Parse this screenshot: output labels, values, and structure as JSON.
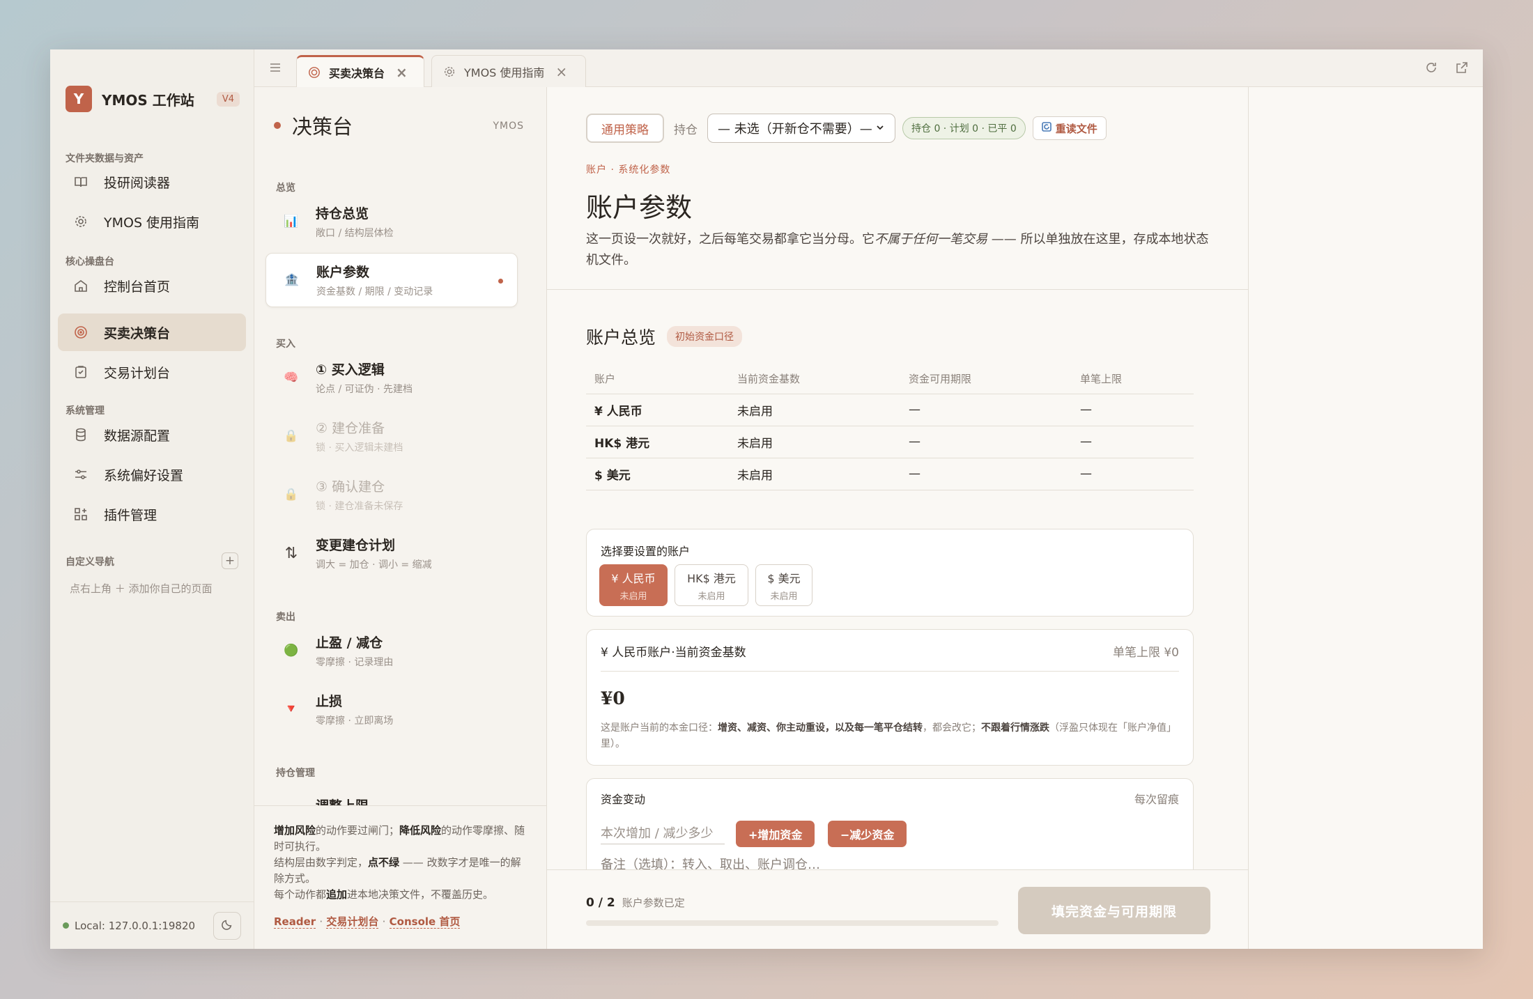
{
  "brand": {
    "logo": "Y",
    "name": "YMOS 工作站",
    "version": "V4"
  },
  "sidebar": {
    "sections": [
      "文件夹数据与资产",
      "核心操盘台",
      "系统管理",
      "自定义导航"
    ],
    "items": [
      {
        "label": "投研阅读器",
        "icon": "book-icon"
      },
      {
        "label": "YMOS 使用指南",
        "icon": "gear-icon"
      },
      {
        "label": "控制台首页",
        "icon": "home-icon"
      },
      {
        "label": "买卖决策台",
        "icon": "target-icon",
        "active": true
      },
      {
        "label": "交易计划台",
        "icon": "clipboard-icon"
      },
      {
        "label": "数据源配置",
        "icon": "database-icon"
      },
      {
        "label": "系统偏好设置",
        "icon": "sliders-icon"
      },
      {
        "label": "插件管理",
        "icon": "plugin-icon"
      }
    ],
    "custom_hint": "点右上角 ＋ 添加你自己的页面",
    "footer": "Local: 127.0.0.1:19820"
  },
  "tabs": [
    {
      "label": "买卖决策台",
      "active": true
    },
    {
      "label": "YMOS 使用指南",
      "active": false
    }
  ],
  "panel": {
    "title": "决策台",
    "tag": "YMOS",
    "sections": [
      "总览",
      "买入",
      "卖出",
      "持仓管理"
    ],
    "items": [
      {
        "title": "持仓总览",
        "sub": "敞口 / 结构层体检",
        "icon": "📊"
      },
      {
        "title": "账户参数",
        "sub": "资金基数 / 期限 / 变动记录",
        "icon": "🏦"
      },
      {
        "title": "① 买入逻辑",
        "sub": "论点 / 可证伪 · 先建档",
        "icon": "🧠"
      },
      {
        "title": "② 建仓准备",
        "sub": "锁 · 买入逻辑未建档",
        "icon": "🔒"
      },
      {
        "title": "③ 确认建仓",
        "sub": "锁 · 建仓准备未保存",
        "icon": "🔒"
      },
      {
        "title": "变更建仓计划",
        "sub": "调大 = 加仓 · 调小 = 缩减",
        "icon": "⇅"
      },
      {
        "title": "止盈 / 减仓",
        "sub": "零摩擦 · 记录理由",
        "icon": "🟢"
      },
      {
        "title": "止损",
        "sub": "零摩擦 · 立即离场",
        "icon": "🔻"
      }
    ],
    "peek": "调整上限",
    "foot": {
      "l1a": "增加风险",
      "l1b": "的动作要过闸门；",
      "l1c": "降低风险",
      "l1d": "的动作零摩擦、随时可执行。",
      "l2a": "结构层由数字判定，",
      "l2b": "点不绿",
      "l2c": " —— 改数字才是唯一的解除方式。",
      "l3a": "每个动作都",
      "l3b": "追加",
      "l3c": "进本地决策文件，不覆盖历史。",
      "links": [
        "Reader",
        "交易计划台",
        "Console 首页"
      ],
      "link_sep": "·"
    }
  },
  "main": {
    "strategy": "通用策略",
    "hold_label": "持仓",
    "hold_select": "— 未选（开新仓不需要）—",
    "status_badge": "持仓 0 · 计划 0 · 已平 0",
    "reread": "重读文件",
    "crumb": "账户 · 系统化参数",
    "title": "账户参数",
    "desc_a": "这一页设一次就好，之后每笔交易都拿它当分母。它",
    "desc_b": "不属于任何一笔交易",
    "desc_c": " —— 所以单独放在这里，存成本地状态机文件。",
    "overview_title": "账户总览",
    "overview_badge": "初始资金口径",
    "table": {
      "headers": [
        "账户",
        "当前资金基数",
        "资金可用期限",
        "单笔上限"
      ],
      "rows": [
        [
          "¥ 人民币",
          "未启用",
          "—",
          "—"
        ],
        [
          "HK$ 港元",
          "未启用",
          "—",
          "—"
        ],
        [
          "$ 美元",
          "未启用",
          "—",
          "—"
        ]
      ]
    },
    "select_label": "选择要设置的账户",
    "accounts": [
      {
        "name": "¥ 人民币",
        "status": "未启用",
        "on": true
      },
      {
        "name": "HK$ 港元",
        "status": "未启用",
        "on": false
      },
      {
        "name": "$ 美元",
        "status": "未启用",
        "on": false
      }
    ],
    "base": {
      "label": "¥ 人民币账户·当前资金基数",
      "limit": "单笔上限 ¥0",
      "amount": "¥0",
      "note_a": "这是账户当前的本金口径：",
      "note_b": "增资、减资、你主动重设，以及每一笔平仓结转",
      "note_c": "，都会改它；",
      "note_d": "不跟着行情涨跌",
      "note_e": "（浮盈只体现在「账户净值」里）。"
    },
    "change": {
      "label": "资金变动",
      "right": "每次留痕",
      "amount_placeholder": "本次增加 / 减少多少",
      "add": "+增加资金",
      "sub": "−减少资金",
      "memo_placeholder": "备注（选填）：转入、取出、账户调仓…"
    },
    "progress": {
      "count": "0 / 2",
      "label": "账户参数已定",
      "fraction": 0.0
    },
    "submit": "填完资金与可用期限"
  }
}
